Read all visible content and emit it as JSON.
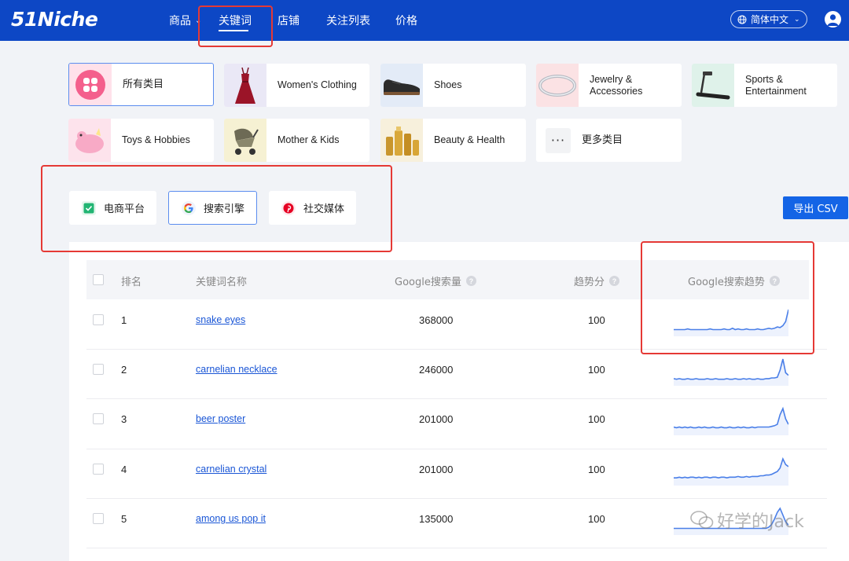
{
  "logo": {
    "text": "51Niche"
  },
  "nav": {
    "items": [
      {
        "label": "商品",
        "has_dropdown": true
      },
      {
        "label": "关键词",
        "active": true
      },
      {
        "label": "店铺"
      },
      {
        "label": "关注列表"
      },
      {
        "label": "价格"
      }
    ],
    "language": "简体中文"
  },
  "categories": [
    {
      "label": "所有类目",
      "active": true,
      "icon": "grid-icon"
    },
    {
      "label": "Women's Clothing",
      "icon": "dress-icon"
    },
    {
      "label": "Shoes",
      "icon": "shoe-icon"
    },
    {
      "label": "Jewelry & Accessories",
      "icon": "bracelet-icon"
    },
    {
      "label": "Sports & Entertainment",
      "icon": "treadmill-icon"
    },
    {
      "label": "Toys & Hobbies",
      "icon": "plush-toy-icon"
    },
    {
      "label": "Mother & Kids",
      "icon": "stroller-icon"
    },
    {
      "label": "Beauty & Health",
      "icon": "cosmetics-icon"
    },
    {
      "label": "更多类目",
      "icon": "more-icon"
    }
  ],
  "sources": [
    {
      "label": "电商平台",
      "icon": "check-icon",
      "color": "#22b573"
    },
    {
      "label": "搜索引擎",
      "icon": "google-icon",
      "color": "#4285f4",
      "active": true
    },
    {
      "label": "社交媒体",
      "icon": "pinterest-icon",
      "color": "#e60023"
    }
  ],
  "export_label": "导出 CSV",
  "table": {
    "headers": {
      "rank": "排名",
      "keyword": "关键词名称",
      "volume": "Google搜索量",
      "score": "趋势分",
      "trend": "Google搜索趋势"
    },
    "rows": [
      {
        "rank": "1",
        "keyword": "snake eyes",
        "volume": "368000",
        "score": "100",
        "trend": [
          10,
          10,
          10,
          10,
          10,
          11,
          10,
          10,
          10,
          10,
          10,
          10,
          10,
          11,
          10,
          10,
          10,
          10,
          11,
          10,
          10,
          12,
          10,
          11,
          10,
          10,
          11,
          10,
          10,
          10,
          11,
          10,
          10,
          11,
          12,
          11,
          12,
          14,
          13,
          16,
          22,
          40
        ]
      },
      {
        "rank": "2",
        "keyword": "carnelian necklace",
        "volume": "246000",
        "score": "100",
        "trend": [
          11,
          10,
          11,
          10,
          10,
          11,
          10,
          10,
          11,
          10,
          10,
          10,
          11,
          10,
          10,
          11,
          10,
          10,
          10,
          11,
          10,
          10,
          11,
          10,
          10,
          11,
          10,
          11,
          10,
          10,
          11,
          10,
          10,
          11,
          11,
          12,
          12,
          13,
          24,
          41,
          20,
          16
        ]
      },
      {
        "rank": "3",
        "keyword": "beer poster",
        "volume": "201000",
        "score": "100",
        "trend": [
          12,
          11,
          12,
          11,
          12,
          11,
          12,
          11,
          11,
          12,
          11,
          12,
          11,
          11,
          12,
          11,
          11,
          12,
          11,
          11,
          12,
          11,
          11,
          12,
          11,
          12,
          11,
          11,
          12,
          11,
          12,
          12,
          12,
          12,
          12,
          13,
          14,
          16,
          30,
          39,
          24,
          16
        ]
      },
      {
        "rank": "4",
        "keyword": "carnelian crystal",
        "volume": "201000",
        "score": "100",
        "trend": [
          11,
          11,
          12,
          11,
          12,
          11,
          12,
          12,
          11,
          12,
          11,
          12,
          12,
          11,
          12,
          12,
          11,
          12,
          12,
          11,
          12,
          12,
          12,
          13,
          12,
          12,
          13,
          12,
          13,
          13,
          13,
          14,
          14,
          15,
          15,
          16,
          18,
          20,
          25,
          38,
          30,
          27
        ]
      },
      {
        "rank": "5",
        "keyword": "among us pop it",
        "volume": "135000",
        "score": "100",
        "trend": [
          10,
          10,
          10,
          10,
          10,
          10,
          10,
          10,
          10,
          10,
          10,
          10,
          10,
          10,
          10,
          10,
          10,
          10,
          10,
          10,
          10,
          10,
          10,
          10,
          10,
          10,
          10,
          10,
          10,
          10,
          10,
          10,
          10,
          10,
          12,
          16,
          24,
          34,
          40,
          30,
          20,
          15
        ]
      }
    ]
  },
  "watermark": "好学的Jack",
  "colors": {
    "nav_bg": "#0d47c5",
    "accent": "#1464e6",
    "link": "#1a56d6",
    "trend_line": "#4a7fe8",
    "annotation": "#e53935"
  }
}
